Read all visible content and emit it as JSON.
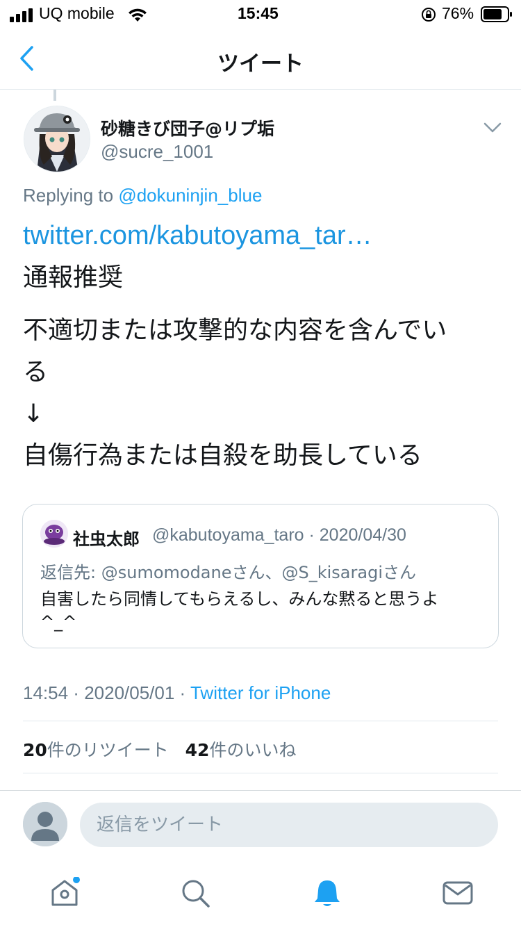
{
  "status_bar": {
    "carrier": "UQ mobile",
    "time": "15:45",
    "battery": "76%"
  },
  "nav": {
    "title": "ツイート"
  },
  "tweet": {
    "author_name": "砂糖きび団子@リプ垢",
    "author_handle": "@sucre_1001",
    "replying_label": "Replying to",
    "replying_handle": "@dokuninjin_blue",
    "link": "twitter.com/kabutoyama_tar…",
    "lines": [
      "通報推奨",
      "不適切または攻撃的な内容を含んでい",
      "る",
      "↓",
      "自傷行為または自殺を助長している"
    ],
    "time": "14:54",
    "date": "2020/05/01",
    "source": "Twitter for iPhone",
    "retweets_count": "20",
    "retweets_label": "件のリツイート",
    "likes_count": "42",
    "likes_label": "件のいいね"
  },
  "quoted": {
    "name": "社虫太郎",
    "handle": "@kabutoyama_taro",
    "date": "2020/04/30",
    "reply_label": "返信先:",
    "reply_handle_1": "@sumomodane",
    "reply_suffix_1": "さん、",
    "reply_handle_2": "@S_kisaragi",
    "reply_suffix_2": "さん",
    "text_line1": "自害したら同情してもらえるし、みんな黙ると思うよ",
    "text_line2": "^_^"
  },
  "reply_box": {
    "placeholder": "返信をツイート"
  },
  "tab_bar": {
    "items": [
      "home-icon",
      "search-icon",
      "notifications-icon",
      "messages-icon"
    ],
    "active": "notifications-icon",
    "accent": "#1da1f2"
  },
  "colors": {
    "accent": "#1da1f2",
    "text": "#14171a",
    "secondary": "#657786"
  }
}
